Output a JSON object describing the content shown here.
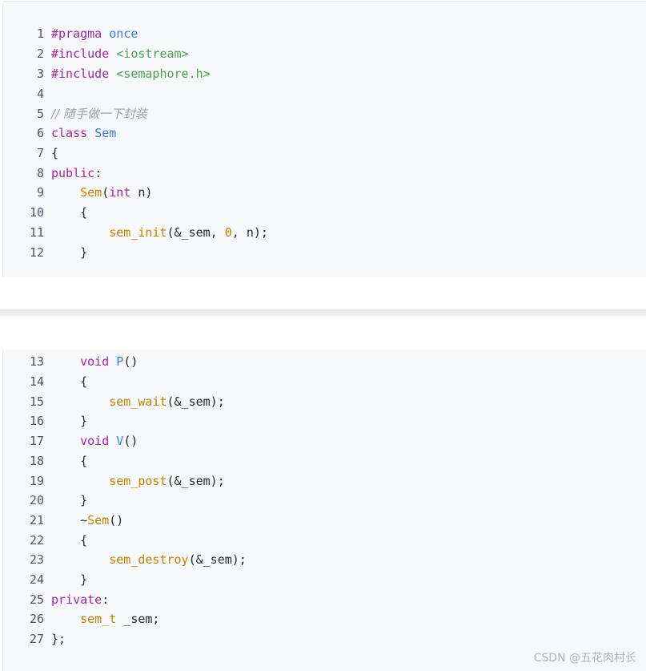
{
  "code": {
    "lines": [
      {
        "num": "1",
        "tokens": [
          {
            "t": "#pragma",
            "c": "pp"
          },
          {
            "t": " ",
            "c": "pl"
          },
          {
            "t": "once",
            "c": "ty"
          }
        ]
      },
      {
        "num": "2",
        "tokens": [
          {
            "t": "#include",
            "c": "pp"
          },
          {
            "t": " ",
            "c": "pl"
          },
          {
            "t": "<iostream>",
            "c": "str"
          }
        ]
      },
      {
        "num": "3",
        "tokens": [
          {
            "t": "#include",
            "c": "pp"
          },
          {
            "t": " ",
            "c": "pl"
          },
          {
            "t": "<semaphore.h>",
            "c": "str"
          }
        ]
      },
      {
        "num": "4",
        "tokens": []
      },
      {
        "num": "5",
        "tokens": [
          {
            "t": "// 随手做一下封装",
            "c": "cm"
          }
        ]
      },
      {
        "num": "6",
        "tokens": [
          {
            "t": "class",
            "c": "kw"
          },
          {
            "t": " ",
            "c": "pl"
          },
          {
            "t": "Sem",
            "c": "ty"
          }
        ]
      },
      {
        "num": "7",
        "tokens": [
          {
            "t": "{",
            "c": "pl"
          }
        ]
      },
      {
        "num": "8",
        "tokens": [
          {
            "t": "public",
            "c": "kw"
          },
          {
            "t": ":",
            "c": "pl"
          }
        ]
      },
      {
        "num": "9",
        "tokens": [
          {
            "t": "    ",
            "c": "pl"
          },
          {
            "t": "Sem",
            "c": "fn"
          },
          {
            "t": "(",
            "c": "pl"
          },
          {
            "t": "int",
            "c": "kw"
          },
          {
            "t": " n)",
            "c": "pl"
          }
        ]
      },
      {
        "num": "10",
        "tokens": [
          {
            "t": "    {",
            "c": "pl"
          }
        ]
      },
      {
        "num": "11",
        "tokens": [
          {
            "t": "        ",
            "c": "pl"
          },
          {
            "t": "sem_init",
            "c": "fn"
          },
          {
            "t": "(&_sem, ",
            "c": "pl"
          },
          {
            "t": "0",
            "c": "num"
          },
          {
            "t": ", n);",
            "c": "pl"
          }
        ]
      },
      {
        "num": "12",
        "tokens": [
          {
            "t": "    }",
            "c": "pl"
          }
        ]
      },
      {
        "num": "13",
        "tokens": [
          {
            "t": "    ",
            "c": "pl"
          },
          {
            "t": "void",
            "c": "kw"
          },
          {
            "t": " ",
            "c": "pl"
          },
          {
            "t": "P",
            "c": "ty"
          },
          {
            "t": "()",
            "c": "pl"
          }
        ]
      },
      {
        "num": "14",
        "tokens": [
          {
            "t": "    {",
            "c": "pl"
          }
        ]
      },
      {
        "num": "15",
        "tokens": [
          {
            "t": "        ",
            "c": "pl"
          },
          {
            "t": "sem_wait",
            "c": "fn"
          },
          {
            "t": "(&_sem);",
            "c": "pl"
          }
        ]
      },
      {
        "num": "16",
        "tokens": [
          {
            "t": "    }",
            "c": "pl"
          }
        ]
      },
      {
        "num": "17",
        "tokens": [
          {
            "t": "    ",
            "c": "pl"
          },
          {
            "t": "void",
            "c": "kw"
          },
          {
            "t": " ",
            "c": "pl"
          },
          {
            "t": "V",
            "c": "ty"
          },
          {
            "t": "()",
            "c": "pl"
          }
        ]
      },
      {
        "num": "18",
        "tokens": [
          {
            "t": "    {",
            "c": "pl"
          }
        ]
      },
      {
        "num": "19",
        "tokens": [
          {
            "t": "        ",
            "c": "pl"
          },
          {
            "t": "sem_post",
            "c": "fn"
          },
          {
            "t": "(&_sem);",
            "c": "pl"
          }
        ]
      },
      {
        "num": "20",
        "tokens": [
          {
            "t": "    }",
            "c": "pl"
          }
        ]
      },
      {
        "num": "21",
        "tokens": [
          {
            "t": "    ~",
            "c": "pl"
          },
          {
            "t": "Sem",
            "c": "fn"
          },
          {
            "t": "()",
            "c": "pl"
          }
        ]
      },
      {
        "num": "22",
        "tokens": [
          {
            "t": "    {",
            "c": "pl"
          }
        ]
      },
      {
        "num": "23",
        "tokens": [
          {
            "t": "        ",
            "c": "pl"
          },
          {
            "t": "sem_destroy",
            "c": "fn"
          },
          {
            "t": "(&_sem);",
            "c": "pl"
          }
        ]
      },
      {
        "num": "24",
        "tokens": [
          {
            "t": "    }",
            "c": "pl"
          }
        ]
      },
      {
        "num": "25",
        "tokens": [
          {
            "t": "private",
            "c": "kw"
          },
          {
            "t": ":",
            "c": "pl"
          }
        ]
      },
      {
        "num": "26",
        "tokens": [
          {
            "t": "    ",
            "c": "pl"
          },
          {
            "t": "sem_t",
            "c": "fn"
          },
          {
            "t": " _sem;",
            "c": "pl"
          }
        ]
      },
      {
        "num": "27",
        "tokens": [
          {
            "t": "};",
            "c": "pl"
          }
        ]
      }
    ]
  },
  "watermark": "CSDN @五花肉村长",
  "colors": {
    "keyword": "#a626a4",
    "string": "#50a14f",
    "type": "#4078f2",
    "function": "#c18401",
    "comment": "#a0a1a7",
    "background": "#f6f8fa"
  }
}
